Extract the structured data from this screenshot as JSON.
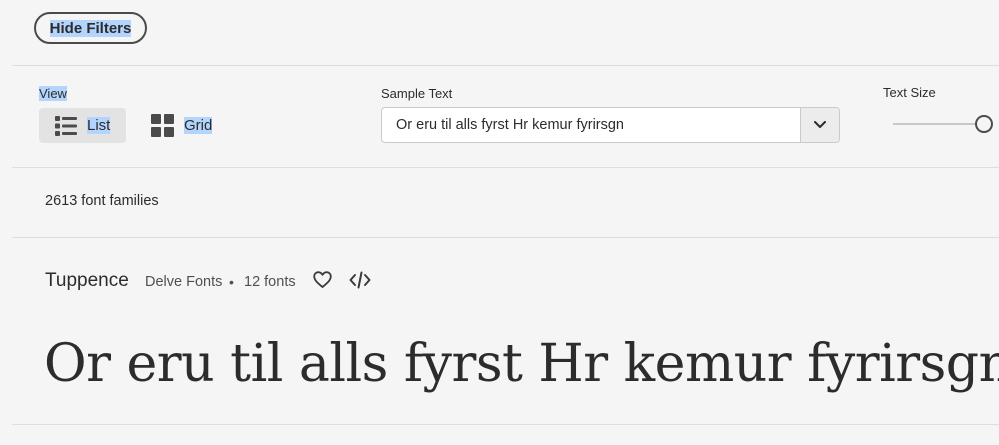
{
  "filters": {
    "hide_label": "Hide Filters"
  },
  "view": {
    "label": "View",
    "options": [
      {
        "label": "List",
        "icon": "list-icon",
        "selected": true
      },
      {
        "label": "Grid",
        "icon": "grid-icon",
        "selected": false
      }
    ]
  },
  "sample_text": {
    "label": "Sample Text",
    "value": "Or eru til alls fyrst Hr kemur fyrirsgn",
    "icon": "chevron-down-icon"
  },
  "text_size": {
    "label": "Text Size",
    "level": 0.98
  },
  "results": {
    "count_text": "2613 font families"
  },
  "font_family": {
    "name": "Tuppence",
    "foundry": "Delve Fonts",
    "separator": "•",
    "fonts_count": "12 fonts",
    "favorite_icon": "heart-icon",
    "code_icon": "code-icon",
    "preview_text": "Or eru til alls fyrst Hr kemur fyrirsgn"
  },
  "colors": {
    "selection_highlight": "#b3d4fc",
    "background": "#f5f5f5",
    "accent": "#4b4b4b"
  }
}
